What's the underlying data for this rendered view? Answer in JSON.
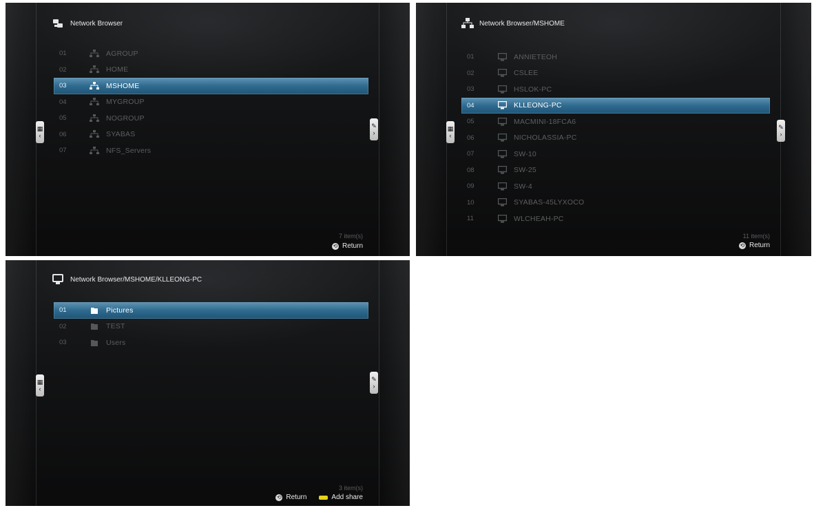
{
  "panel1": {
    "title": "Network Browser",
    "rows": [
      {
        "num": "01",
        "label": "AGROUP"
      },
      {
        "num": "02",
        "label": "HOME"
      },
      {
        "num": "03",
        "label": "MSHOME"
      },
      {
        "num": "04",
        "label": "MYGROUP"
      },
      {
        "num": "05",
        "label": "NOGROUP"
      },
      {
        "num": "06",
        "label": "SYABAS"
      },
      {
        "num": "07",
        "label": "NFS_Servers"
      }
    ],
    "selected_index": 2,
    "count": "7 item(s)",
    "return_label": "Return"
  },
  "panel2": {
    "title": "Network Browser/MSHOME",
    "rows": [
      {
        "num": "01",
        "label": "ANNIETEOH"
      },
      {
        "num": "02",
        "label": "CSLEE"
      },
      {
        "num": "03",
        "label": "HSLOK-PC"
      },
      {
        "num": "04",
        "label": "KLLEONG-PC"
      },
      {
        "num": "05",
        "label": "MACMINI-18FCA6"
      },
      {
        "num": "06",
        "label": "NICHOLASSIA-PC"
      },
      {
        "num": "07",
        "label": "SW-10"
      },
      {
        "num": "08",
        "label": "SW-25"
      },
      {
        "num": "09",
        "label": "SW-4"
      },
      {
        "num": "10",
        "label": "SYABAS-45LYXOCO"
      },
      {
        "num": "11",
        "label": "WLCHEAH-PC"
      }
    ],
    "selected_index": 3,
    "count": "11 item(s)",
    "return_label": "Return"
  },
  "panel3": {
    "title": "Network Browser/MSHOME/KLLEONG-PC",
    "rows": [
      {
        "num": "01",
        "label": "Pictures"
      },
      {
        "num": "02",
        "label": "TEST"
      },
      {
        "num": "03",
        "label": "Users"
      }
    ],
    "selected_index": 0,
    "count": "3 item(s)",
    "return_label": "Return",
    "add_share_label": "Add share"
  },
  "side_tabs": {
    "left_glyph": "‹",
    "right_glyph": "›"
  },
  "icons": {
    "header1": "network-icon",
    "header2": "network-icon",
    "header3": "computer-icon",
    "rows1": "workgroup-icon",
    "rows2": "computer-icon",
    "rows3": "folder-icon"
  },
  "colors": {
    "selection": "#2f6a8f",
    "return_key": "#dcdcdc",
    "add_share_key": "#e6d21a"
  }
}
